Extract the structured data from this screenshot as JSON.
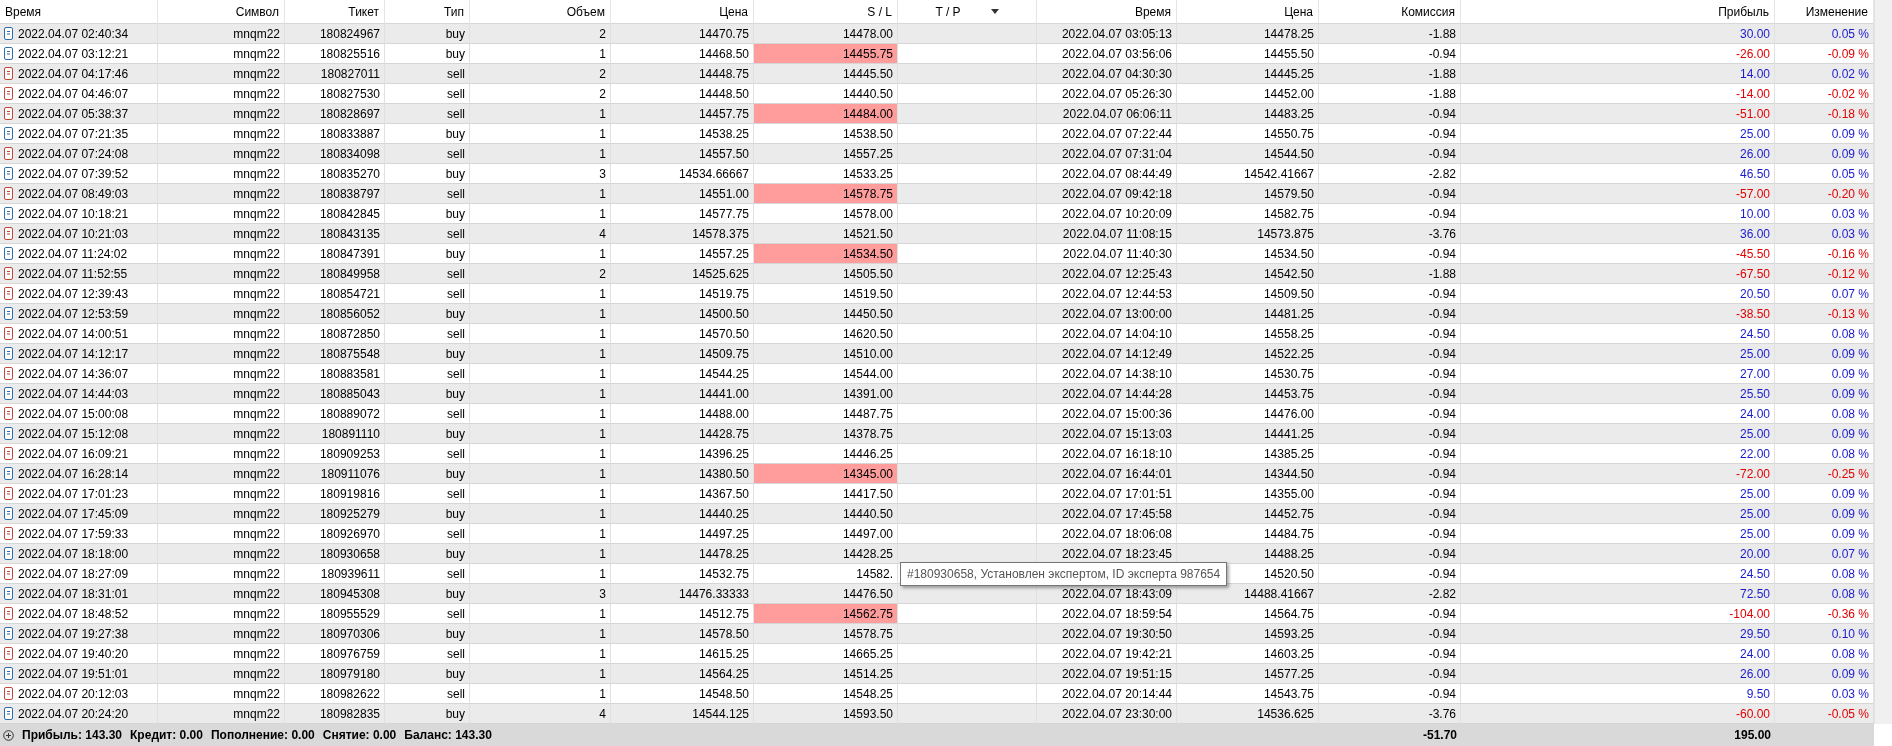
{
  "columns": [
    {
      "label": "Время"
    },
    {
      "label": "Символ"
    },
    {
      "label": "Тикет"
    },
    {
      "label": "Тип"
    },
    {
      "label": "Объем"
    },
    {
      "label": "Цена"
    },
    {
      "label": "S / L"
    },
    {
      "label": "T / P",
      "sorted": true
    },
    {
      "label": "Время"
    },
    {
      "label": "Цена"
    },
    {
      "label": "Комиссия"
    },
    {
      "label": "Прибыль"
    },
    {
      "label": "Изменение"
    }
  ],
  "rows": [
    {
      "kind": "buy",
      "open_time": "2022.04.07 02:40:34",
      "symbol": "mnqm22",
      "ticket": "180824967",
      "type": "buy",
      "volume": "2",
      "price": "14470.75",
      "sl": "14478.00",
      "sl_hit": false,
      "close_time": "2022.04.07 03:05:13",
      "close_price": "14478.25",
      "commission": "-1.88",
      "profit": "30.00",
      "change": "0.05 %",
      "loss": false
    },
    {
      "kind": "buy",
      "open_time": "2022.04.07 03:12:21",
      "symbol": "mnqm22",
      "ticket": "180825516",
      "type": "buy",
      "volume": "1",
      "price": "14468.50",
      "sl": "14455.75",
      "sl_hit": true,
      "close_time": "2022.04.07 03:56:06",
      "close_price": "14455.50",
      "commission": "-0.94",
      "profit": "-26.00",
      "change": "-0.09 %",
      "loss": true
    },
    {
      "kind": "sell",
      "open_time": "2022.04.07 04:17:46",
      "symbol": "mnqm22",
      "ticket": "180827011",
      "type": "sell",
      "volume": "2",
      "price": "14448.75",
      "sl": "14445.50",
      "sl_hit": false,
      "close_time": "2022.04.07 04:30:30",
      "close_price": "14445.25",
      "commission": "-1.88",
      "profit": "14.00",
      "change": "0.02 %",
      "loss": false
    },
    {
      "kind": "sell",
      "open_time": "2022.04.07 04:46:07",
      "symbol": "mnqm22",
      "ticket": "180827530",
      "type": "sell",
      "volume": "2",
      "price": "14448.50",
      "sl": "14440.50",
      "sl_hit": false,
      "close_time": "2022.04.07 05:26:30",
      "close_price": "14452.00",
      "commission": "-1.88",
      "profit": "-14.00",
      "change": "-0.02 %",
      "loss": true
    },
    {
      "kind": "sell",
      "open_time": "2022.04.07 05:38:37",
      "symbol": "mnqm22",
      "ticket": "180828697",
      "type": "sell",
      "volume": "1",
      "price": "14457.75",
      "sl": "14484.00",
      "sl_hit": true,
      "close_time": "2022.04.07 06:06:11",
      "close_price": "14483.25",
      "commission": "-0.94",
      "profit": "-51.00",
      "change": "-0.18 %",
      "loss": true
    },
    {
      "kind": "buy",
      "open_time": "2022.04.07 07:21:35",
      "symbol": "mnqm22",
      "ticket": "180833887",
      "type": "buy",
      "volume": "1",
      "price": "14538.25",
      "sl": "14538.50",
      "sl_hit": false,
      "close_time": "2022.04.07 07:22:44",
      "close_price": "14550.75",
      "commission": "-0.94",
      "profit": "25.00",
      "change": "0.09 %",
      "loss": false
    },
    {
      "kind": "sell",
      "open_time": "2022.04.07 07:24:08",
      "symbol": "mnqm22",
      "ticket": "180834098",
      "type": "sell",
      "volume": "1",
      "price": "14557.50",
      "sl": "14557.25",
      "sl_hit": false,
      "close_time": "2022.04.07 07:31:04",
      "close_price": "14544.50",
      "commission": "-0.94",
      "profit": "26.00",
      "change": "0.09 %",
      "loss": false
    },
    {
      "kind": "buy",
      "open_time": "2022.04.07 07:39:52",
      "symbol": "mnqm22",
      "ticket": "180835270",
      "type": "buy",
      "volume": "3",
      "price": "14534.66667",
      "sl": "14533.25",
      "sl_hit": false,
      "close_time": "2022.04.07 08:44:49",
      "close_price": "14542.41667",
      "commission": "-2.82",
      "profit": "46.50",
      "change": "0.05 %",
      "loss": false
    },
    {
      "kind": "sell",
      "open_time": "2022.04.07 08:49:03",
      "symbol": "mnqm22",
      "ticket": "180838797",
      "type": "sell",
      "volume": "1",
      "price": "14551.00",
      "sl": "14578.75",
      "sl_hit": true,
      "close_time": "2022.04.07 09:42:18",
      "close_price": "14579.50",
      "commission": "-0.94",
      "profit": "-57.00",
      "change": "-0.20 %",
      "loss": true
    },
    {
      "kind": "buy",
      "open_time": "2022.04.07 10:18:21",
      "symbol": "mnqm22",
      "ticket": "180842845",
      "type": "buy",
      "volume": "1",
      "price": "14577.75",
      "sl": "14578.00",
      "sl_hit": false,
      "close_time": "2022.04.07 10:20:09",
      "close_price": "14582.75",
      "commission": "-0.94",
      "profit": "10.00",
      "change": "0.03 %",
      "loss": false
    },
    {
      "kind": "sell",
      "open_time": "2022.04.07 10:21:03",
      "symbol": "mnqm22",
      "ticket": "180843135",
      "type": "sell",
      "volume": "4",
      "price": "14578.375",
      "sl": "14521.50",
      "sl_hit": false,
      "close_time": "2022.04.07 11:08:15",
      "close_price": "14573.875",
      "commission": "-3.76",
      "profit": "36.00",
      "change": "0.03 %",
      "loss": false
    },
    {
      "kind": "buy",
      "open_time": "2022.04.07 11:24:02",
      "symbol": "mnqm22",
      "ticket": "180847391",
      "type": "buy",
      "volume": "1",
      "price": "14557.25",
      "sl": "14534.50",
      "sl_hit": true,
      "close_time": "2022.04.07 11:40:30",
      "close_price": "14534.50",
      "commission": "-0.94",
      "profit": "-45.50",
      "change": "-0.16 %",
      "loss": true
    },
    {
      "kind": "sell",
      "open_time": "2022.04.07 11:52:55",
      "symbol": "mnqm22",
      "ticket": "180849958",
      "type": "sell",
      "volume": "2",
      "price": "14525.625",
      "sl": "14505.50",
      "sl_hit": false,
      "close_time": "2022.04.07 12:25:43",
      "close_price": "14542.50",
      "commission": "-1.88",
      "profit": "-67.50",
      "change": "-0.12 %",
      "loss": true
    },
    {
      "kind": "sell",
      "open_time": "2022.04.07 12:39:43",
      "symbol": "mnqm22",
      "ticket": "180854721",
      "type": "sell",
      "volume": "1",
      "price": "14519.75",
      "sl": "14519.50",
      "sl_hit": false,
      "close_time": "2022.04.07 12:44:53",
      "close_price": "14509.50",
      "commission": "-0.94",
      "profit": "20.50",
      "change": "0.07 %",
      "loss": false
    },
    {
      "kind": "buy",
      "open_time": "2022.04.07 12:53:59",
      "symbol": "mnqm22",
      "ticket": "180856052",
      "type": "buy",
      "volume": "1",
      "price": "14500.50",
      "sl": "14450.50",
      "sl_hit": false,
      "close_time": "2022.04.07 13:00:00",
      "close_price": "14481.25",
      "commission": "-0.94",
      "profit": "-38.50",
      "change": "-0.13 %",
      "loss": true
    },
    {
      "kind": "sell",
      "open_time": "2022.04.07 14:00:51",
      "symbol": "mnqm22",
      "ticket": "180872850",
      "type": "sell",
      "volume": "1",
      "price": "14570.50",
      "sl": "14620.50",
      "sl_hit": false,
      "close_time": "2022.04.07 14:04:10",
      "close_price": "14558.25",
      "commission": "-0.94",
      "profit": "24.50",
      "change": "0.08 %",
      "loss": false
    },
    {
      "kind": "buy",
      "open_time": "2022.04.07 14:12:17",
      "symbol": "mnqm22",
      "ticket": "180875548",
      "type": "buy",
      "volume": "1",
      "price": "14509.75",
      "sl": "14510.00",
      "sl_hit": false,
      "close_time": "2022.04.07 14:12:49",
      "close_price": "14522.25",
      "commission": "-0.94",
      "profit": "25.00",
      "change": "0.09 %",
      "loss": false
    },
    {
      "kind": "sell",
      "open_time": "2022.04.07 14:36:07",
      "symbol": "mnqm22",
      "ticket": "180883581",
      "type": "sell",
      "volume": "1",
      "price": "14544.25",
      "sl": "14544.00",
      "sl_hit": false,
      "close_time": "2022.04.07 14:38:10",
      "close_price": "14530.75",
      "commission": "-0.94",
      "profit": "27.00",
      "change": "0.09 %",
      "loss": false
    },
    {
      "kind": "buy",
      "open_time": "2022.04.07 14:44:03",
      "symbol": "mnqm22",
      "ticket": "180885043",
      "type": "buy",
      "volume": "1",
      "price": "14441.00",
      "sl": "14391.00",
      "sl_hit": false,
      "close_time": "2022.04.07 14:44:28",
      "close_price": "14453.75",
      "commission": "-0.94",
      "profit": "25.50",
      "change": "0.09 %",
      "loss": false
    },
    {
      "kind": "sell",
      "open_time": "2022.04.07 15:00:08",
      "symbol": "mnqm22",
      "ticket": "180889072",
      "type": "sell",
      "volume": "1",
      "price": "14488.00",
      "sl": "14487.75",
      "sl_hit": false,
      "close_time": "2022.04.07 15:00:36",
      "close_price": "14476.00",
      "commission": "-0.94",
      "profit": "24.00",
      "change": "0.08 %",
      "loss": false
    },
    {
      "kind": "buy",
      "open_time": "2022.04.07 15:12:08",
      "symbol": "mnqm22",
      "ticket": "180891110",
      "type": "buy",
      "volume": "1",
      "price": "14428.75",
      "sl": "14378.75",
      "sl_hit": false,
      "close_time": "2022.04.07 15:13:03",
      "close_price": "14441.25",
      "commission": "-0.94",
      "profit": "25.00",
      "change": "0.09 %",
      "loss": false
    },
    {
      "kind": "sell",
      "open_time": "2022.04.07 16:09:21",
      "symbol": "mnqm22",
      "ticket": "180909253",
      "type": "sell",
      "volume": "1",
      "price": "14396.25",
      "sl": "14446.25",
      "sl_hit": false,
      "close_time": "2022.04.07 16:18:10",
      "close_price": "14385.25",
      "commission": "-0.94",
      "profit": "22.00",
      "change": "0.08 %",
      "loss": false
    },
    {
      "kind": "buy",
      "open_time": "2022.04.07 16:28:14",
      "symbol": "mnqm22",
      "ticket": "180911076",
      "type": "buy",
      "volume": "1",
      "price": "14380.50",
      "sl": "14345.00",
      "sl_hit": true,
      "close_time": "2022.04.07 16:44:01",
      "close_price": "14344.50",
      "commission": "-0.94",
      "profit": "-72.00",
      "change": "-0.25 %",
      "loss": true
    },
    {
      "kind": "sell",
      "open_time": "2022.04.07 17:01:23",
      "symbol": "mnqm22",
      "ticket": "180919816",
      "type": "sell",
      "volume": "1",
      "price": "14367.50",
      "sl": "14417.50",
      "sl_hit": false,
      "close_time": "2022.04.07 17:01:51",
      "close_price": "14355.00",
      "commission": "-0.94",
      "profit": "25.00",
      "change": "0.09 %",
      "loss": false
    },
    {
      "kind": "buy",
      "open_time": "2022.04.07 17:45:09",
      "symbol": "mnqm22",
      "ticket": "180925279",
      "type": "buy",
      "volume": "1",
      "price": "14440.25",
      "sl": "14440.50",
      "sl_hit": false,
      "close_time": "2022.04.07 17:45:58",
      "close_price": "14452.75",
      "commission": "-0.94",
      "profit": "25.00",
      "change": "0.09 %",
      "loss": false
    },
    {
      "kind": "sell",
      "open_time": "2022.04.07 17:59:33",
      "symbol": "mnqm22",
      "ticket": "180926970",
      "type": "sell",
      "volume": "1",
      "price": "14497.25",
      "sl": "14497.00",
      "sl_hit": false,
      "close_time": "2022.04.07 18:06:08",
      "close_price": "14484.75",
      "commission": "-0.94",
      "profit": "25.00",
      "change": "0.09 %",
      "loss": false
    },
    {
      "kind": "buy",
      "open_time": "2022.04.07 18:18:00",
      "symbol": "mnqm22",
      "ticket": "180930658",
      "type": "buy",
      "volume": "1",
      "price": "14478.25",
      "sl": "14428.25",
      "sl_hit": false,
      "close_time": "2022.04.07 18:23:45",
      "close_price": "14488.25",
      "commission": "-0.94",
      "profit": "20.00",
      "change": "0.07 %",
      "loss": false
    },
    {
      "kind": "sell",
      "open_time": "2022.04.07 18:27:09",
      "symbol": "mnqm22",
      "ticket": "180939611",
      "type": "sell",
      "volume": "1",
      "price": "14532.75",
      "sl": "14582.",
      "sl_hit": false,
      "close_price": "14520.50",
      "commission": "-0.94",
      "profit": "24.50",
      "change": "0.08 %",
      "loss": false,
      "tooltip": "#180930658, Установлен экспертом, ID эксперта 987654"
    },
    {
      "kind": "buy",
      "open_time": "2022.04.07 18:31:01",
      "symbol": "mnqm22",
      "ticket": "180945308",
      "type": "buy",
      "volume": "3",
      "price": "14476.33333",
      "sl": "14476.50",
      "sl_hit": false,
      "close_time": "2022.04.07 18:43:09",
      "close_price": "14488.41667",
      "commission": "-2.82",
      "profit": "72.50",
      "change": "0.08 %",
      "loss": false
    },
    {
      "kind": "sell",
      "open_time": "2022.04.07 18:48:52",
      "symbol": "mnqm22",
      "ticket": "180955529",
      "type": "sell",
      "volume": "1",
      "price": "14512.75",
      "sl": "14562.75",
      "sl_hit": true,
      "close_time": "2022.04.07 18:59:54",
      "close_price": "14564.75",
      "commission": "-0.94",
      "profit": "-104.00",
      "change": "-0.36 %",
      "loss": true
    },
    {
      "kind": "buy",
      "open_time": "2022.04.07 19:27:38",
      "symbol": "mnqm22",
      "ticket": "180970306",
      "type": "buy",
      "volume": "1",
      "price": "14578.50",
      "sl": "14578.75",
      "sl_hit": false,
      "close_time": "2022.04.07 19:30:50",
      "close_price": "14593.25",
      "commission": "-0.94",
      "profit": "29.50",
      "change": "0.10 %",
      "loss": false
    },
    {
      "kind": "sell",
      "open_time": "2022.04.07 19:40:20",
      "symbol": "mnqm22",
      "ticket": "180976759",
      "type": "sell",
      "volume": "1",
      "price": "14615.25",
      "sl": "14665.25",
      "sl_hit": false,
      "close_time": "2022.04.07 19:42:21",
      "close_price": "14603.25",
      "commission": "-0.94",
      "profit": "24.00",
      "change": "0.08 %",
      "loss": false
    },
    {
      "kind": "buy",
      "open_time": "2022.04.07 19:51:01",
      "symbol": "mnqm22",
      "ticket": "180979180",
      "type": "buy",
      "volume": "1",
      "price": "14564.25",
      "sl": "14514.25",
      "sl_hit": false,
      "close_time": "2022.04.07 19:51:15",
      "close_price": "14577.25",
      "commission": "-0.94",
      "profit": "26.00",
      "change": "0.09 %",
      "loss": false
    },
    {
      "kind": "sell",
      "open_time": "2022.04.07 20:12:03",
      "symbol": "mnqm22",
      "ticket": "180982622",
      "type": "sell",
      "volume": "1",
      "price": "14548.50",
      "sl": "14548.25",
      "sl_hit": false,
      "close_time": "2022.04.07 20:14:44",
      "close_price": "14543.75",
      "commission": "-0.94",
      "profit": "9.50",
      "change": "0.03 %",
      "loss": false
    },
    {
      "kind": "buy",
      "open_time": "2022.04.07 20:24:20",
      "symbol": "mnqm22",
      "ticket": "180982835",
      "type": "buy",
      "volume": "4",
      "price": "14544.125",
      "sl": "14593.50",
      "sl_hit": false,
      "close_time": "2022.04.07 23:30:00",
      "close_price": "14536.625",
      "commission": "-3.76",
      "profit": "-60.00",
      "change": "-0.05 %",
      "loss": true
    }
  ],
  "footer": {
    "summary": [
      {
        "label": "Прибыль:",
        "value": "143.30"
      },
      {
        "label": "Кредит:",
        "value": "0.00"
      },
      {
        "label": "Пополнение:",
        "value": "0.00"
      },
      {
        "label": "Снятие:",
        "value": "0.00"
      },
      {
        "label": "Баланс:",
        "value": "143.30"
      }
    ],
    "commission_total": "-51.70",
    "profit_total": "195.00"
  }
}
